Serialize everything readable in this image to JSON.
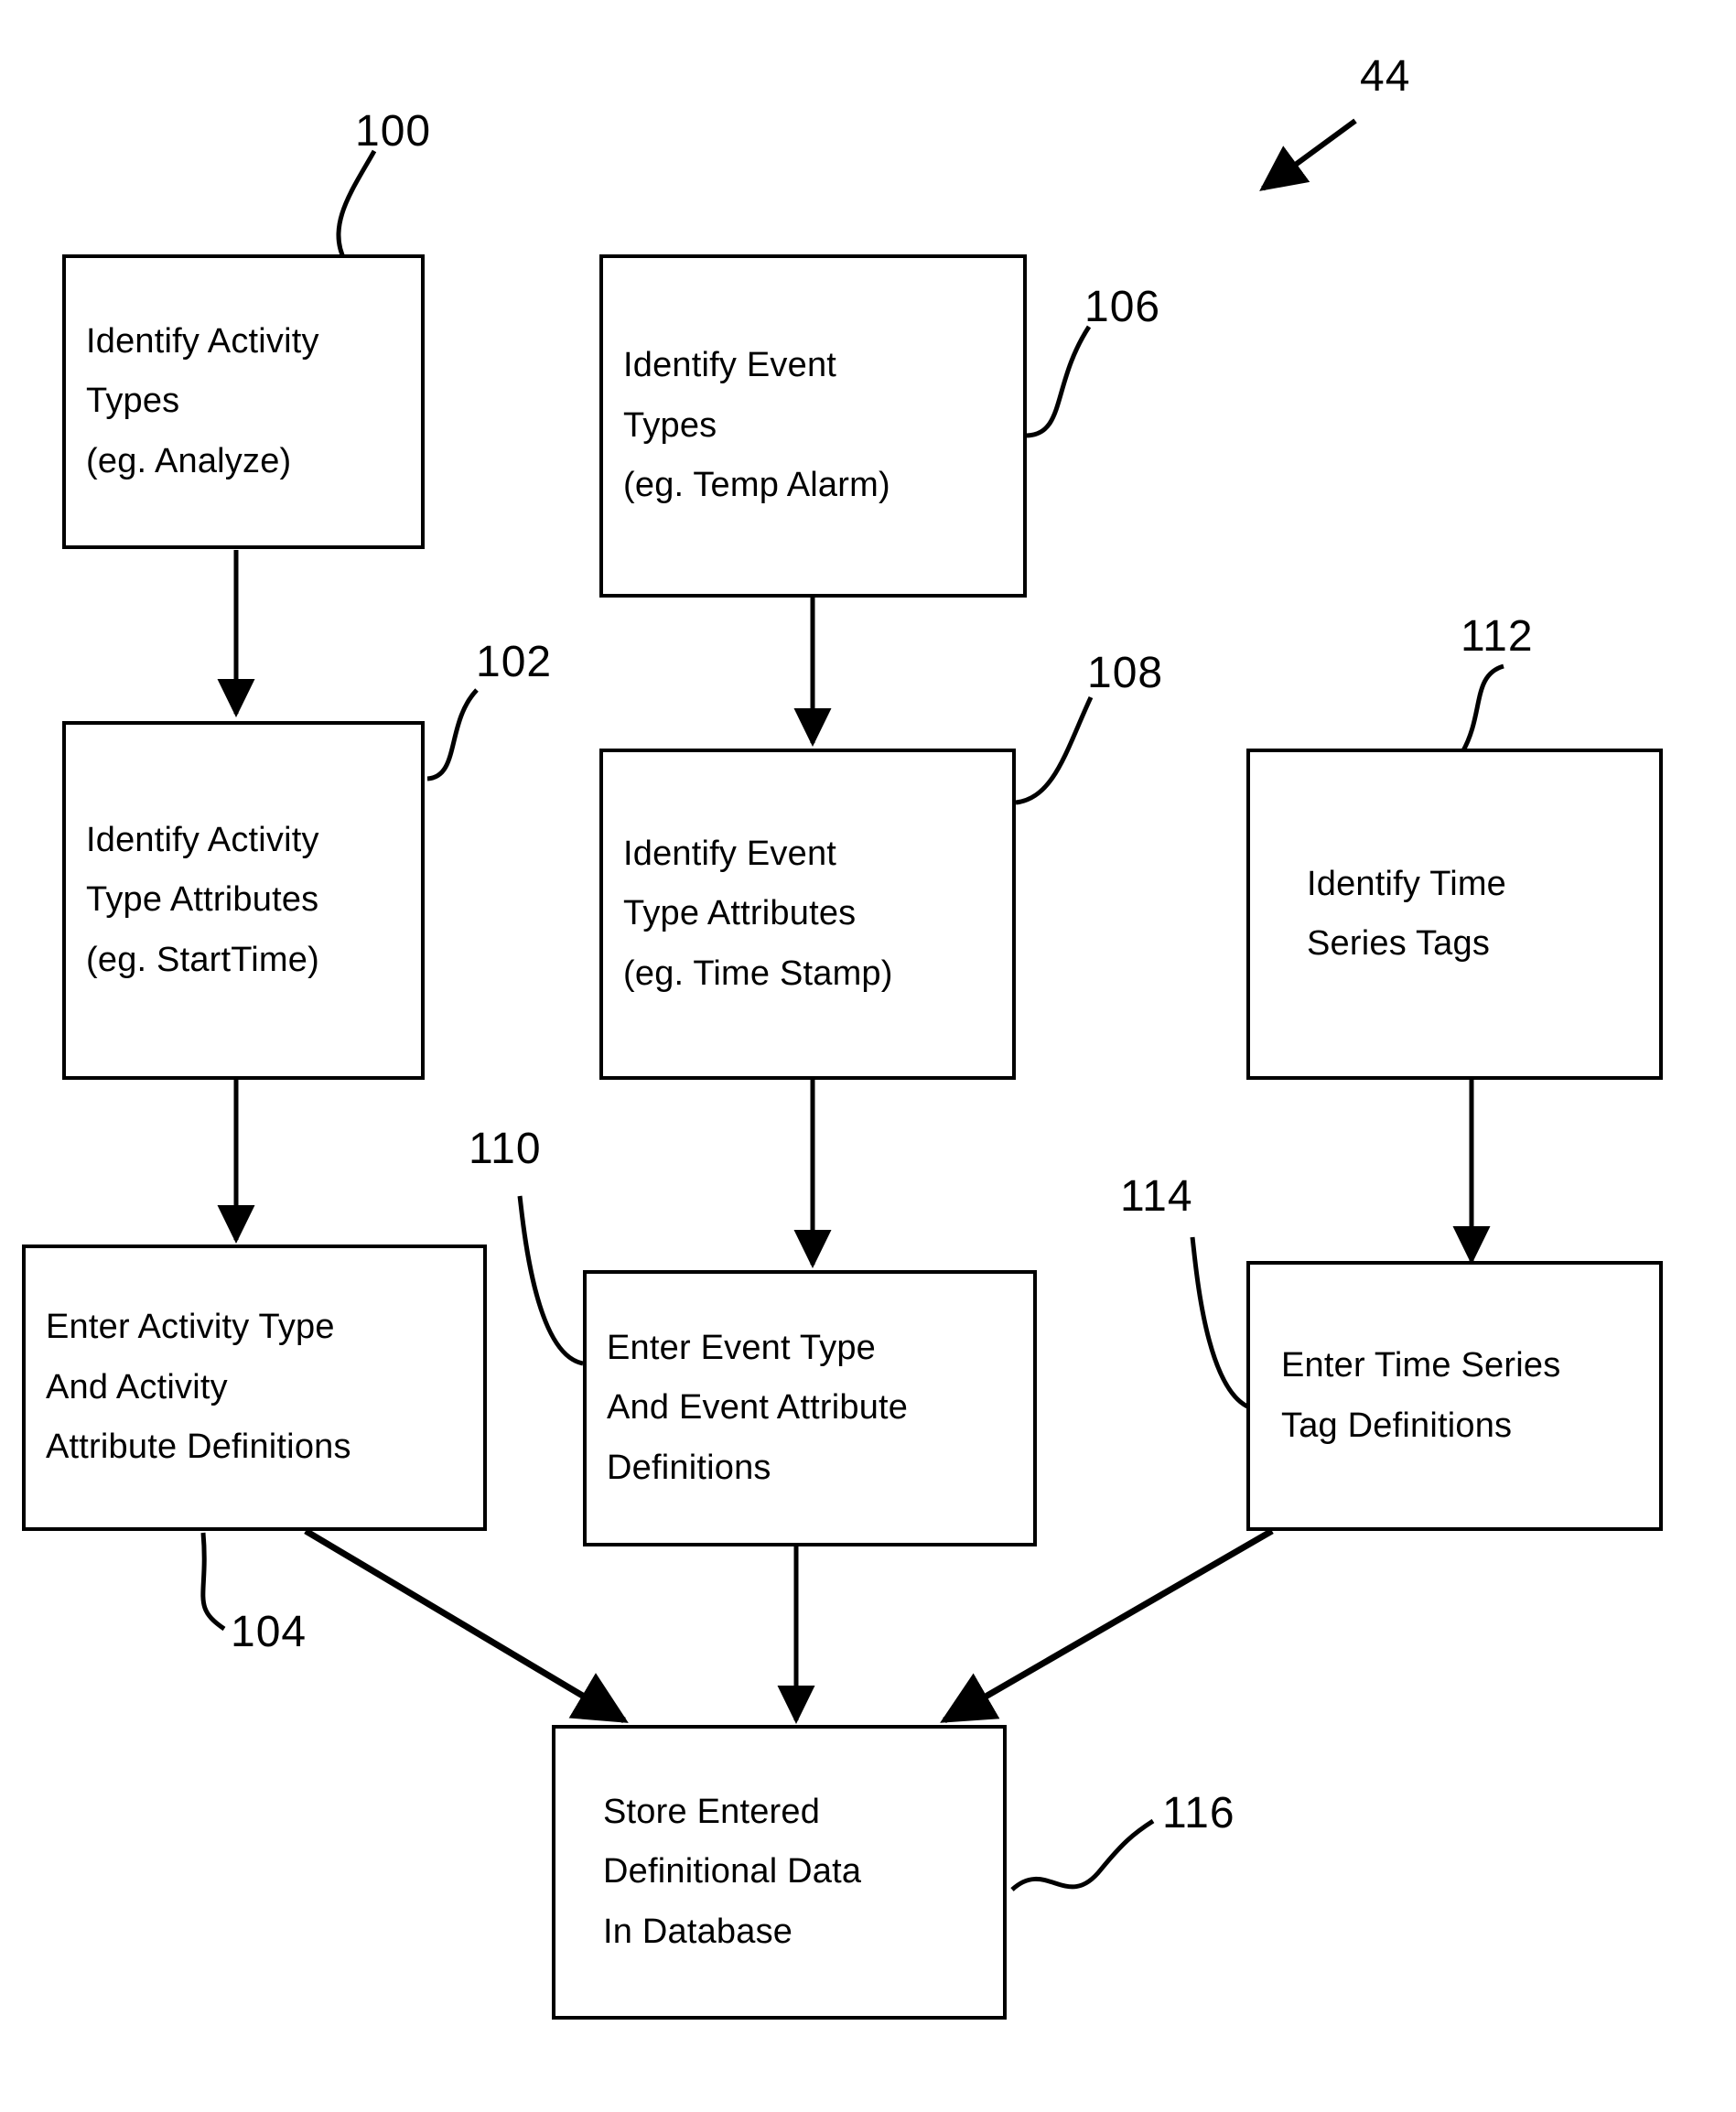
{
  "figure": {
    "figure_ref": "44"
  },
  "nodes": [
    {
      "id": "identify-activity-types",
      "ref": "100",
      "lines": [
        "Identify Activity",
        "Types",
        "(eg. Analyze)"
      ]
    },
    {
      "id": "identify-activity-type-attributes",
      "ref": "102",
      "lines": [
        "Identify Activity",
        "Type Attributes",
        "(eg. StartTime)"
      ]
    },
    {
      "id": "enter-activity-type-and-activity-attribute-definitions",
      "ref": "104",
      "lines": [
        "Enter Activity Type",
        "And Activity",
        "Attribute Definitions"
      ]
    },
    {
      "id": "identify-event-types",
      "ref": "106",
      "lines": [
        "Identify Event",
        "Types",
        "(eg. Temp Alarm)"
      ]
    },
    {
      "id": "identify-event-type-attributes",
      "ref": "108",
      "lines": [
        "Identify Event",
        "Type Attributes",
        "(eg. Time Stamp)"
      ]
    },
    {
      "id": "enter-event-type-and-event-attribute-definitions",
      "ref": "110",
      "lines": [
        "Enter Event Type",
        "And Event Attribute",
        "Definitions"
      ]
    },
    {
      "id": "identify-time-series-tags",
      "ref": "112",
      "lines": [
        "Identify Time",
        "Series Tags"
      ]
    },
    {
      "id": "enter-time-series-tag-definitions",
      "ref": "114",
      "lines": [
        "Enter Time Series",
        "Tag Definitions"
      ]
    },
    {
      "id": "store-entered-definitional-data-in-database",
      "ref": "116",
      "lines": [
        "Store Entered",
        "Definitional Data",
        "In Database"
      ]
    }
  ]
}
